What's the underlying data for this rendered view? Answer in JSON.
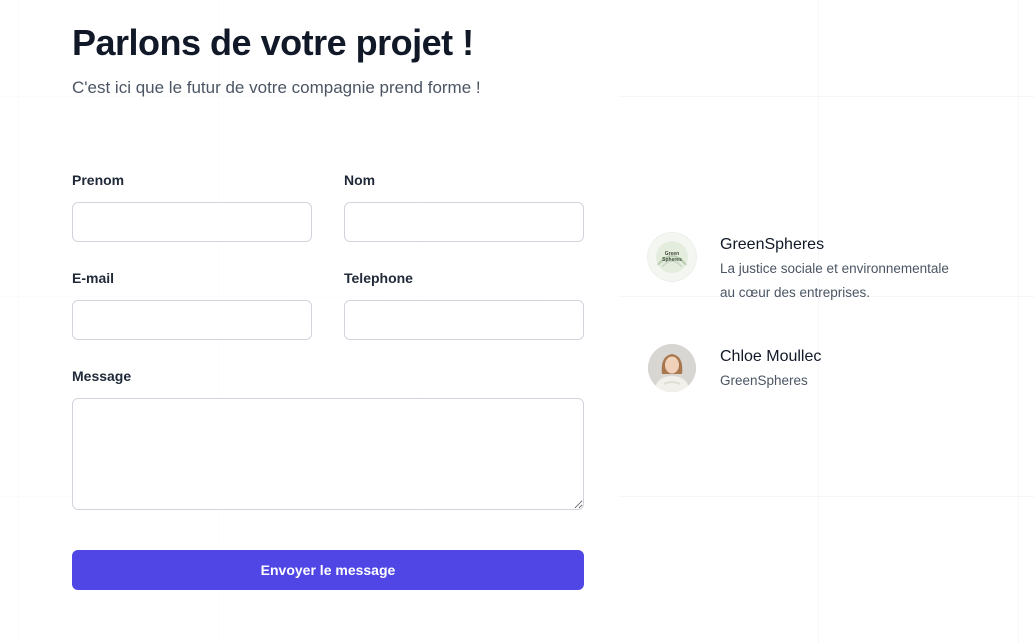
{
  "header": {
    "title": "Parlons de votre projet !",
    "subtitle": "C'est ici que le futur de votre compagnie prend forme !"
  },
  "form": {
    "first_name": {
      "label": "Prenom",
      "value": "",
      "placeholder": ""
    },
    "last_name": {
      "label": "Nom",
      "value": "",
      "placeholder": ""
    },
    "email": {
      "label": "E-mail",
      "value": "",
      "placeholder": ""
    },
    "phone": {
      "label": "Telephone",
      "value": "",
      "placeholder": ""
    },
    "message": {
      "label": "Message",
      "value": "",
      "placeholder": ""
    },
    "submit_label": "Envoyer le message"
  },
  "company": {
    "name": "GreenSpheres",
    "description_line1": "La justice sociale et environnementale",
    "description_line2": "au cœur des entreprises.",
    "logo_text_line1": "Green",
    "logo_text_line2": "Spheres"
  },
  "person": {
    "name": "Chloe Moullec",
    "role": "GreenSpheres"
  },
  "colors": {
    "accent": "#4f46e5",
    "text": "#111827",
    "muted": "#4b5563",
    "border": "#d1d5db"
  }
}
